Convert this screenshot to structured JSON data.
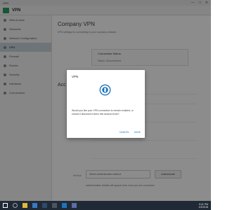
{
  "window": {
    "title": "VPN",
    "controls": [
      "—",
      "□",
      "✕"
    ]
  },
  "header": {
    "title": "VPN"
  },
  "sidebar": {
    "items": [
      {
        "label": "Web Access",
        "icon": "globe-icon",
        "active": false
      },
      {
        "label": "Networks",
        "icon": "network-icon",
        "active": false
      },
      {
        "label": "Network Configuration",
        "icon": "settings-icon",
        "active": false
      },
      {
        "label": "VPN",
        "icon": "vpn-icon",
        "active": true
      },
      {
        "label": "Firewall",
        "icon": "firewall-icon",
        "active": false
      },
      {
        "label": "Routes",
        "icon": "route-icon",
        "active": false
      },
      {
        "label": "Security",
        "icon": "shield-icon",
        "active": false
      },
      {
        "label": "Hardware",
        "icon": "hardware-icon",
        "active": false
      },
      {
        "label": "Connections",
        "icon": "connection-icon",
        "active": false
      }
    ]
  },
  "main": {
    "title": "Company VPN",
    "description": "VPN settings for connecting to your company network.",
    "card_title": "Connection Status",
    "card_subtitle": "Status: Disconnected",
    "section_heading": "Acc",
    "status_line": "Personal info (SSO)",
    "method_label": "Method",
    "method_select_value": "Select authentication method",
    "method_button_label": "Authenticate",
    "help_text": "Authentication details will appear here once you are connected."
  },
  "dialog": {
    "title": "VPN",
    "icon": "vpn-logo-icon",
    "body": "Would you like your VPN connection to remain enabled, or should it disconnect when this session ends?",
    "cancel_label": "CANCEL",
    "confirm_label": "SAVE"
  },
  "taskbar": {
    "time": "5:41 PM",
    "date": "1/3/2018"
  },
  "colors": {
    "accent": "#1e73be",
    "brand": "#2e9a63",
    "taskbar": "#1f2a36",
    "overlay": "rgba(0,0,0,0.45)"
  }
}
